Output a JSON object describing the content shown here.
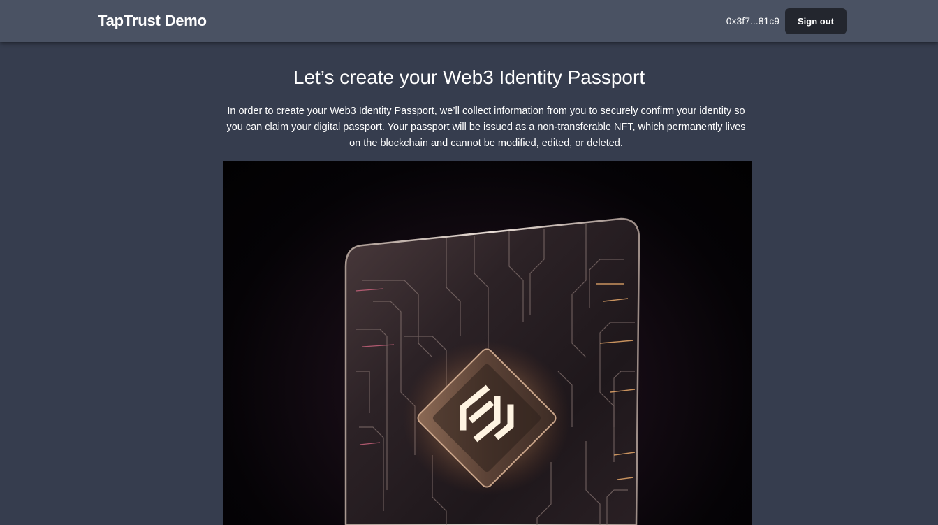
{
  "header": {
    "brand": "TapTrust Demo",
    "wallet_address": "0x3f7...81c9",
    "signout_label": "Sign out"
  },
  "main": {
    "title": "Let’s create your Web3 Identity Passport",
    "description": "In order to create your Web3 Identity Passport, we’ll collect information from you to securely confirm your identity so you can claim your digital passport. Your passport will be issued as a non-transferable NFT, which permanently lives on the blockchain and cannot be modified, edited, or deleted.",
    "hero_image": "passport-chip-card-image"
  },
  "colors": {
    "page_background": "#363d4e",
    "header_background": "#4a5263",
    "button_background": "#23262e",
    "text": "#ffffff"
  }
}
